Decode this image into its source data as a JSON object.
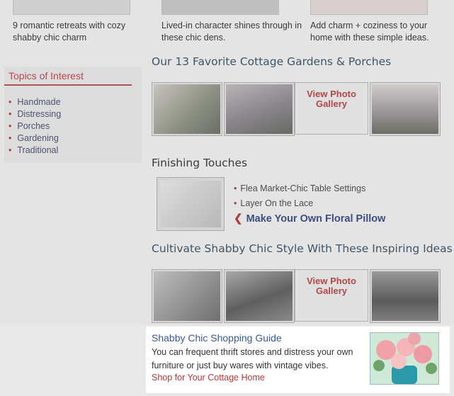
{
  "captions": [
    "9 romantic retreats with cozy shabby chic charm",
    "Lived-in character shines through in these chic dens.",
    "Add charm + coziness to your home with these simple ideas."
  ],
  "sidebar": {
    "title": "Topics of Interest",
    "items": [
      "Handmade",
      "Distressing",
      "Porches",
      "Gardening",
      "Traditional"
    ]
  },
  "gardens": {
    "title": "Our 13 Favorite Cottage Gardens & Porches",
    "gallery_label": "View Photo Gallery"
  },
  "finishing": {
    "title": "Finishing Touches",
    "links": [
      "Flea Market-Chic Table Settings",
      "Layer On the Lace"
    ],
    "featured": "Make Your Own Floral Pillow"
  },
  "shabby": {
    "title": "Cultivate Shabby Chic Style With These Inspiring Ideas",
    "gallery_label": "View Photo Gallery"
  },
  "shopping": {
    "title": "Shabby Chic Shopping Guide",
    "description": "You can frequent thrift stores and distress your own furniture or just buy wares with vintage vibes.",
    "link": "Shop for Your Cottage Home"
  }
}
